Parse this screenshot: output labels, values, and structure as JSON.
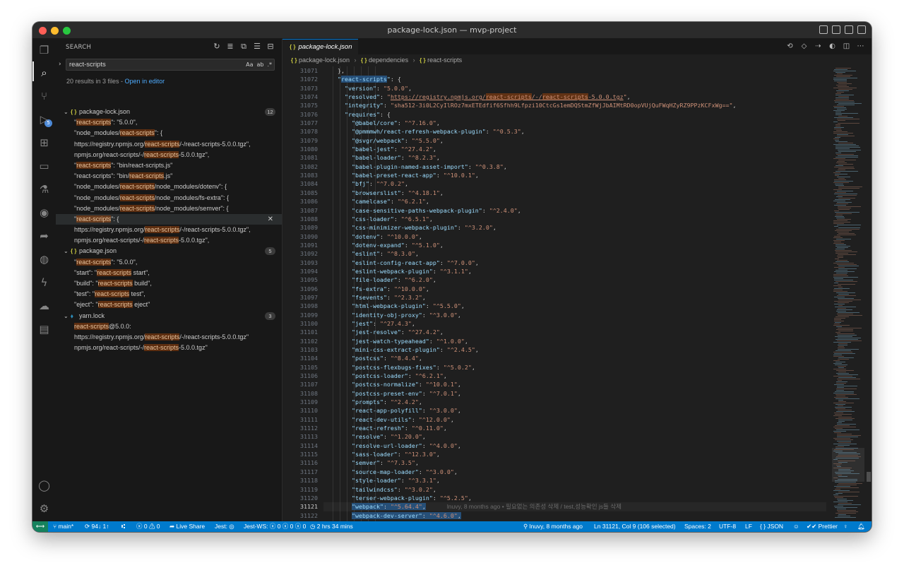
{
  "window": {
    "title": "package-lock.json — mvp-project"
  },
  "activity": {
    "scm_badge": "5"
  },
  "sidebar": {
    "header": "SEARCH",
    "query": "react-scripts",
    "options": [
      "Aa",
      "ab",
      ".*"
    ],
    "summary": "20 results in 3 files - ",
    "open_in_editor": "Open in editor",
    "files": [
      {
        "name": "package-lock.json",
        "count": "12",
        "icon": "{ }",
        "matches": [
          [
            "\"",
            "react-scripts",
            "\": \"5.0.0\","
          ],
          [
            "\"node_modules/",
            "react-scripts",
            "\": {"
          ],
          [
            "https://registry.npmjs.org/",
            "react-scripts",
            "/-/react-scripts-5.0.0.tgz\","
          ],
          [
            "npmjs.org/react-scripts/-/",
            "react-scripts",
            "-5.0.0.tgz\","
          ],
          [
            "\"",
            "react-scripts",
            "\": \"bin/react-scripts.js\""
          ],
          [
            "\"react-scripts\": \"bin/",
            "react-scripts",
            ".js\""
          ],
          [
            "\"node_modules/",
            "react-scripts",
            "/node_modules/dotenv\": {"
          ],
          [
            "\"node_modules/",
            "react-scripts",
            "/node_modules/fs-extra\": {"
          ],
          [
            "\"node_modules/",
            "react-scripts",
            "/node_modules/semver\": {"
          ],
          [
            "\"",
            "react-scripts",
            "\": {"
          ],
          [
            "https://registry.npmjs.org/",
            "react-scripts",
            "/-/react-scripts-5.0.0.tgz\","
          ],
          [
            "npmjs.org/react-scripts/-/",
            "react-scripts",
            "-5.0.0.tgz\","
          ]
        ]
      },
      {
        "name": "package.json",
        "count": "5",
        "icon": "{ }",
        "matches": [
          [
            "\"",
            "react-scripts",
            "\": \"5.0.0\","
          ],
          [
            "\"start\": \"",
            "react-scripts",
            " start\","
          ],
          [
            "\"build\": \"",
            "react-scripts",
            " build\","
          ],
          [
            "\"test\": \"",
            "react-scripts",
            " test\","
          ],
          [
            "\"eject\": \"",
            "react-scripts",
            " eject\""
          ]
        ]
      },
      {
        "name": "yarn.lock",
        "count": "3",
        "icon": "⬧",
        "matches": [
          [
            "",
            "react-scripts",
            "@5.0.0:"
          ],
          [
            "https://registry.npmjs.org/",
            "react-scripts",
            "/-/react-scripts-5.0.0.tgz\""
          ],
          [
            "npmjs.org/react-scripts/-/",
            "react-scripts",
            "-5.0.0.tgz\""
          ]
        ]
      }
    ]
  },
  "editor": {
    "tab": "package-lock.json",
    "breadcrumb": [
      "package-lock.json",
      "dependencies",
      "react-scripts"
    ],
    "first_line": 31071,
    "current_line": 31121,
    "blame_text": "lnuvy, 8 months ago • 필요없는 의존성 삭제 / test,성능확인 js들 삭제",
    "react_scripts": {
      "key": "react-scripts",
      "version": "5.0.0",
      "resolved_pre": "https://registry.npmjs.org/",
      "resolved_mid": "/-/",
      "resolved_post": "-5.0.0.tgz",
      "integrity": "sha512-3i0L2CyIlROz7mxETEdfif6Sfhh9Lfpzi10CtcGs1emDQStmZfWjJbAIMtRD0opVUjQuFWqHZyRZ9PPzKCFxWg=="
    },
    "requires": [
      [
        "@babel/core",
        "^7.16.0"
      ],
      [
        "@pmmmwh/react-refresh-webpack-plugin",
        "^0.5.3"
      ],
      [
        "@svgr/webpack",
        "^5.5.0"
      ],
      [
        "babel-jest",
        "^27.4.2"
      ],
      [
        "babel-loader",
        "^8.2.3"
      ],
      [
        "babel-plugin-named-asset-import",
        "^0.3.8"
      ],
      [
        "babel-preset-react-app",
        "^10.0.1"
      ],
      [
        "bfj",
        "^7.0.2"
      ],
      [
        "browserslist",
        "^4.18.1"
      ],
      [
        "camelcase",
        "^6.2.1"
      ],
      [
        "case-sensitive-paths-webpack-plugin",
        "^2.4.0"
      ],
      [
        "css-loader",
        "^6.5.1"
      ],
      [
        "css-minimizer-webpack-plugin",
        "^3.2.0"
      ],
      [
        "dotenv",
        "^10.0.0"
      ],
      [
        "dotenv-expand",
        "^5.1.0"
      ],
      [
        "eslint",
        "^8.3.0"
      ],
      [
        "eslint-config-react-app",
        "^7.0.0"
      ],
      [
        "eslint-webpack-plugin",
        "^3.1.1"
      ],
      [
        "file-loader",
        "^6.2.0"
      ],
      [
        "fs-extra",
        "^10.0.0"
      ],
      [
        "fsevents",
        "^2.3.2"
      ],
      [
        "html-webpack-plugin",
        "^5.5.0"
      ],
      [
        "identity-obj-proxy",
        "^3.0.0"
      ],
      [
        "jest",
        "^27.4.3"
      ],
      [
        "jest-resolve",
        "^27.4.2"
      ],
      [
        "jest-watch-typeahead",
        "^1.0.0"
      ],
      [
        "mini-css-extract-plugin",
        "^2.4.5"
      ],
      [
        "postcss",
        "^8.4.4"
      ],
      [
        "postcss-flexbugs-fixes",
        "^5.0.2"
      ],
      [
        "postcss-loader",
        "^6.2.1"
      ],
      [
        "postcss-normalize",
        "^10.0.1"
      ],
      [
        "postcss-preset-env",
        "^7.0.1"
      ],
      [
        "prompts",
        "^2.4.2"
      ],
      [
        "react-app-polyfill",
        "^3.0.0"
      ],
      [
        "react-dev-utils",
        "^12.0.0"
      ],
      [
        "react-refresh",
        "^0.11.0"
      ],
      [
        "resolve",
        "^1.20.0"
      ],
      [
        "resolve-url-loader",
        "^4.0.0"
      ],
      [
        "sass-loader",
        "^12.3.0"
      ],
      [
        "semver",
        "^7.3.5"
      ],
      [
        "source-map-loader",
        "^3.0.0"
      ],
      [
        "style-loader",
        "^3.3.1"
      ],
      [
        "tailwindcss",
        "^3.0.2"
      ],
      [
        "terser-webpack-plugin",
        "^5.2.5"
      ],
      [
        "webpack",
        "^5.64.4"
      ],
      [
        "webpack-dev-server",
        "^4.6.0"
      ]
    ]
  },
  "statusbar": {
    "branch": "main*",
    "sync": "94↓ 1↑",
    "problems": "ⓧ 0 ⚠ 0",
    "live_share": "Live Share",
    "jest": "Jest: ◎",
    "jest_ws": "Jest-WS: ⓧ 0 ⓧ 0 ⓧ 0",
    "timer": "2 hrs 34 mins",
    "blame": "lnuvy, 8 months ago",
    "cursor": "Ln 31121, Col 9 (106 selected)",
    "spaces": "Spaces: 2",
    "encoding": "UTF-8",
    "eol": "LF",
    "language": "{ } JSON",
    "prettier": "✔✔ Prettier"
  },
  "colors": {
    "accent": "#007acc",
    "match_highlight": "#ea5c00",
    "selection": "#264f78",
    "link": "#4daafc"
  }
}
